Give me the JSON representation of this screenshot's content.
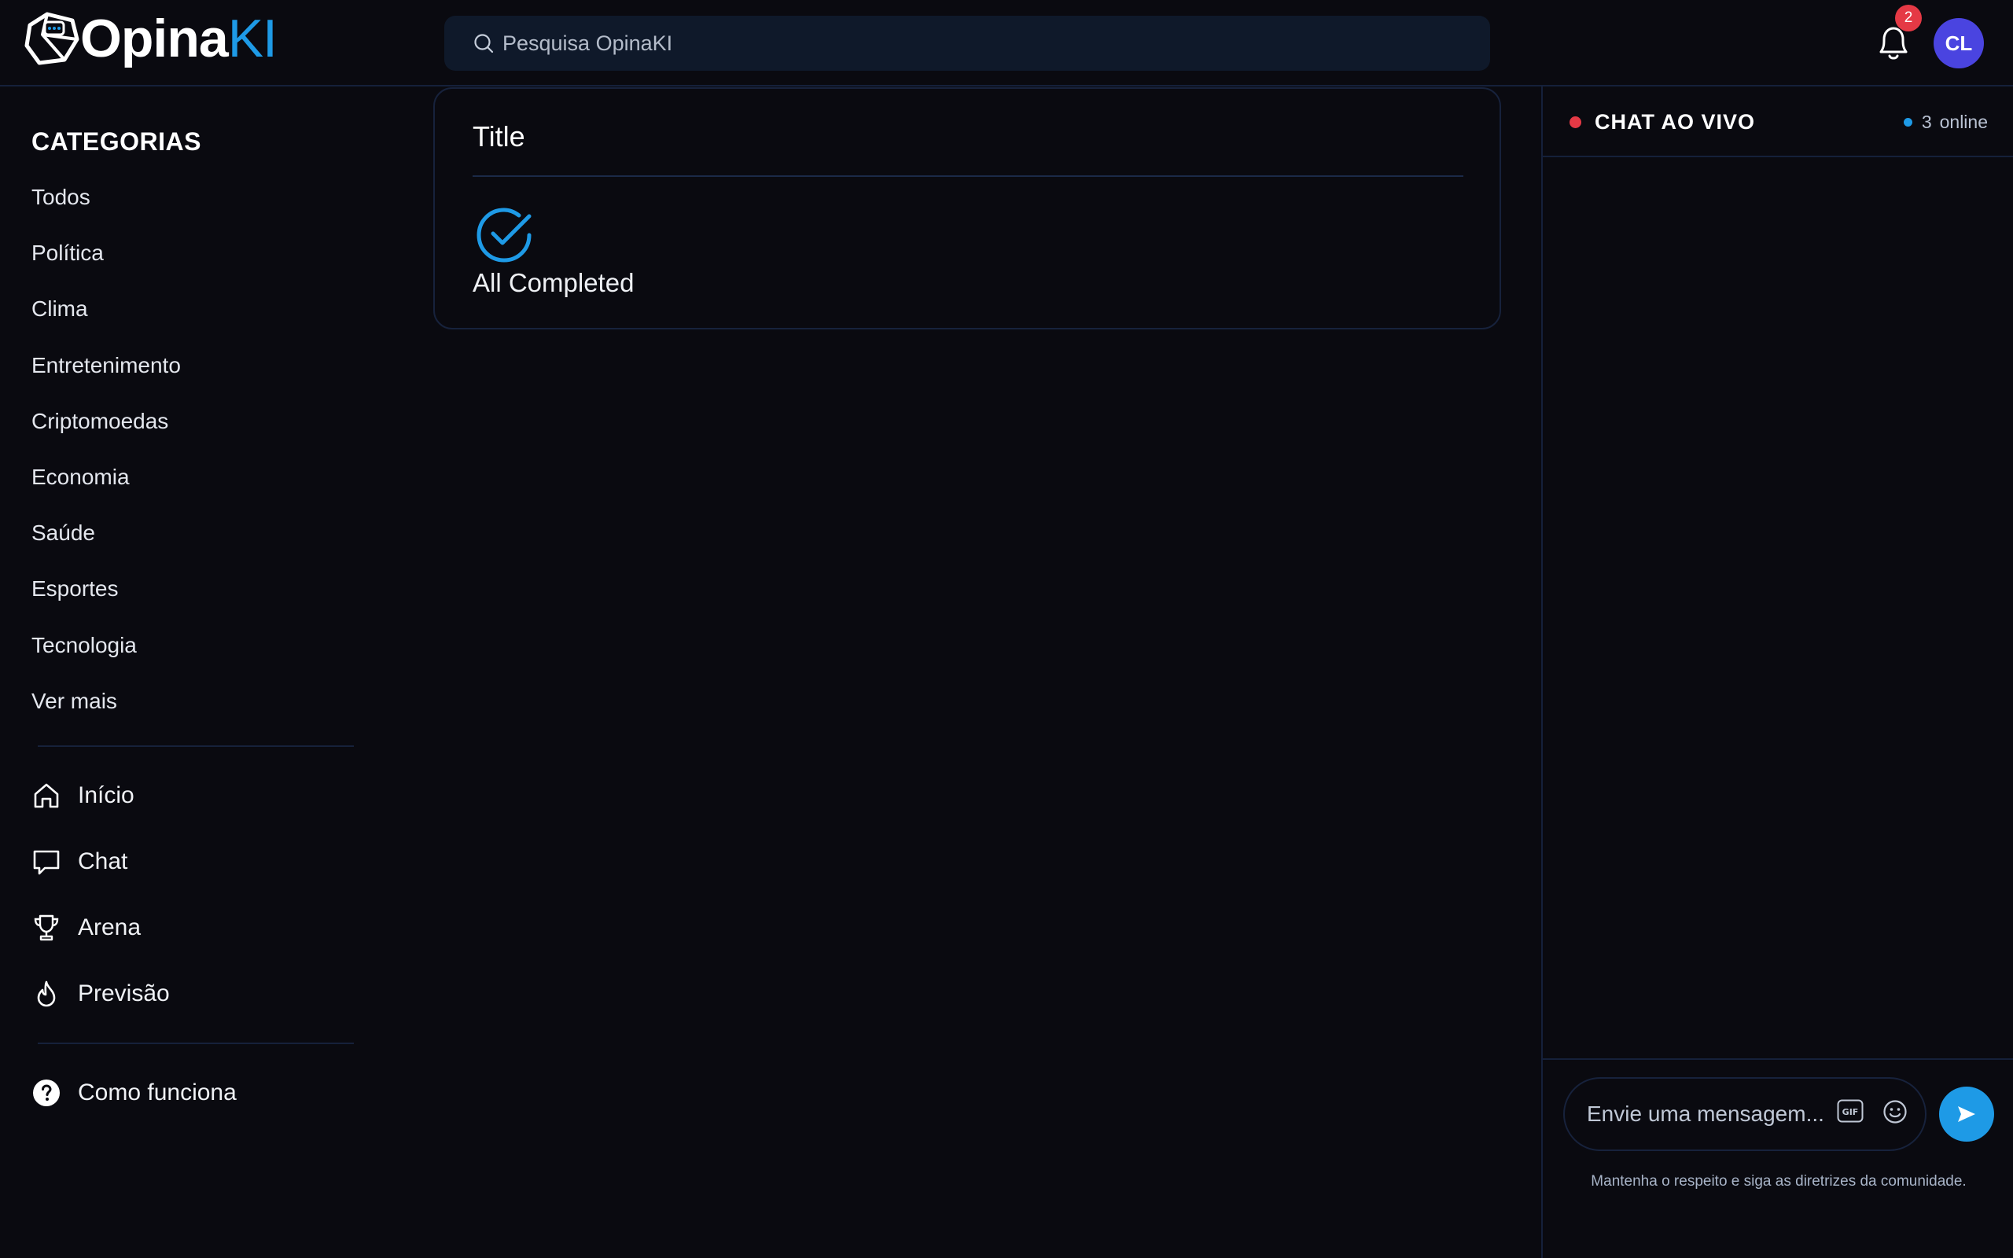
{
  "header": {
    "logo": {
      "brand_main": "Opina",
      "brand_accent": "KI"
    },
    "search": {
      "placeholder": "Pesquisa OpinaKI"
    },
    "notifications": {
      "count": "2"
    },
    "avatar": {
      "initials": "CL"
    }
  },
  "sidebar": {
    "categories_title": "CATEGORIAS",
    "categories": [
      "Todos",
      "Política",
      "Clima",
      "Entretenimento",
      "Criptomoedas",
      "Economia",
      "Saúde",
      "Esportes",
      "Tecnologia",
      "Ver mais"
    ],
    "nav": [
      {
        "label": "Início",
        "icon": "home-icon"
      },
      {
        "label": "Chat",
        "icon": "chat-bubble-icon"
      },
      {
        "label": "Arena",
        "icon": "trophy-icon"
      },
      {
        "label": "Previsão",
        "icon": "flame-icon"
      }
    ],
    "help": {
      "label": "Como funciona",
      "icon": "help-circle-icon"
    }
  },
  "main": {
    "panel": {
      "title": "Title",
      "status": "All Completed",
      "status_icon": "check-circle-icon"
    }
  },
  "chat": {
    "title": "CHAT AO VIVO",
    "online_count": "3",
    "online_label": "online",
    "input_placeholder": "Envie uma mensagem...",
    "guidelines": "Mantenha o respeito e siga as diretrizes da comunidade."
  },
  "colors": {
    "background": "#0a0a10",
    "accent": "#1e9ae6",
    "live": "#e53945",
    "avatar": "#4a44e0",
    "border": "#15203a"
  }
}
